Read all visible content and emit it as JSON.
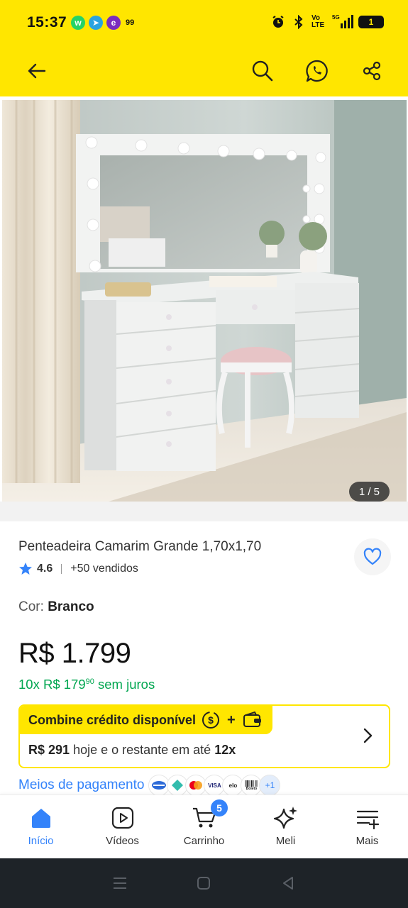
{
  "status_bar": {
    "time": "15:37",
    "notif_count": "99",
    "network_label": "Vo LTE",
    "signal_label": "5G",
    "battery": "1"
  },
  "header": {
    "back_icon": "arrow-left-icon",
    "search_icon": "search-icon",
    "chat_icon": "whatsapp-icon",
    "share_icon": "share-icon"
  },
  "gallery": {
    "counter": "1 / 5"
  },
  "product": {
    "title": "Penteadeira Camarim Grande 1,70x1,70",
    "rating": "4.6",
    "sold": "+50 vendidos",
    "color_label": "Cor:",
    "color_value": "Branco",
    "price": "R$ 1.799",
    "installments_prefix": "10x R$ 179",
    "installments_cents": "90",
    "installments_suffix": "sem juros"
  },
  "credit": {
    "title": "Combine crédito disponível",
    "plus": "+",
    "amount": "R$ 291",
    "middle_text": "hoje e o restante em até",
    "times": "12x"
  },
  "payment": {
    "link": "Meios de pagamento",
    "more": "+1",
    "brands": [
      "visa",
      "elo",
      "boleto"
    ]
  },
  "bottom_nav": {
    "items": [
      {
        "label": "Início",
        "icon": "home-icon"
      },
      {
        "label": "Vídeos",
        "icon": "play-icon"
      },
      {
        "label": "Carrinho",
        "icon": "cart-icon"
      },
      {
        "label": "Meli",
        "icon": "sparkle-icon"
      },
      {
        "label": "Mais",
        "icon": "menu-plus-icon"
      }
    ],
    "cart_badge": "5"
  },
  "colors": {
    "brand_yellow": "#ffe600",
    "link_blue": "#3483fa",
    "green": "#00a650"
  }
}
